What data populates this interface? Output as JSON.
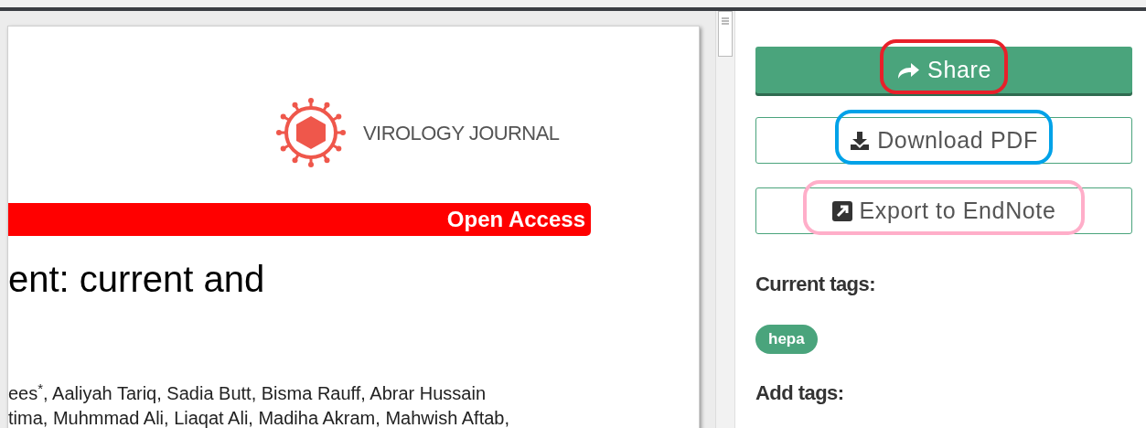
{
  "document": {
    "journal": "VIROLOGY JOURNAL",
    "banner": "Open Access",
    "title_fragment": "ent: current and",
    "author_lines": [
      "ees$^{*}$, Aaliyah Tariq, Sadia Butt, Bisma Rauff, Abrar Hussain",
      "tima, Muhmmad Ali, Liaqat Ali, Madiha Akram, Mahwish Aftab,"
    ]
  },
  "sidebar": {
    "buttons": [
      {
        "kind": "primary",
        "label": "Share",
        "color": "#e8202a"
      },
      {
        "kind": "outline",
        "label": "Download PDF",
        "color": "#00a2e8"
      },
      {
        "kind": "outline",
        "label": "Export to EndNote",
        "color": "#ffaec9"
      }
    ],
    "current_tags_heading": "Current tags:",
    "tags": [
      "hepa"
    ],
    "add_tags_heading": "Add tags:"
  }
}
